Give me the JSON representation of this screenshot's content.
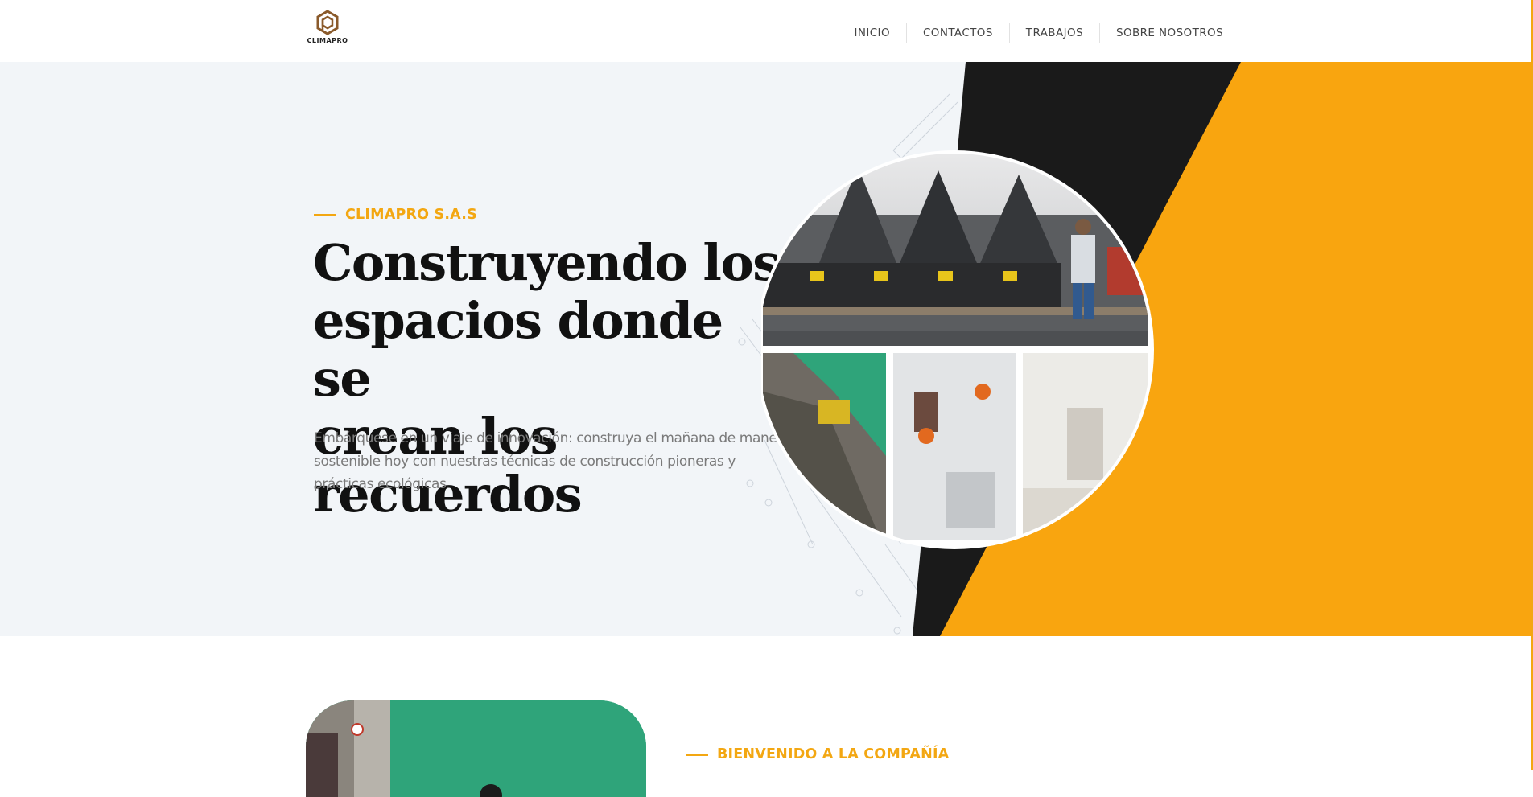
{
  "brand": {
    "name": "CLIMAPRO"
  },
  "nav": {
    "items": [
      {
        "label": "INICIO"
      },
      {
        "label": "CONTACTOS"
      },
      {
        "label": "TRABAJOS"
      },
      {
        "label": "SOBRE NOSOTROS"
      }
    ]
  },
  "hero": {
    "eyebrow": "CLIMAPRO S.A.S",
    "title_lines": [
      "Construyendo los",
      "espacios donde se",
      "crean los recuerdos"
    ],
    "description_lines": [
      "Embárquese en un viaje de innovación: construya el mañana de manera",
      "sostenible hoy con nuestras técnicas de construcción pioneras y",
      "prácticas ecológicas."
    ]
  },
  "about": {
    "eyebrow": "BIENVENIDO A LA COMPAÑÍA"
  },
  "colors": {
    "accent": "#f3a712",
    "dark": "#1a1a1a",
    "hero_bg": "#f2f5f8",
    "text_muted": "#7a7a7a"
  },
  "icons": {
    "logo": "hexagon-logo-icon"
  }
}
